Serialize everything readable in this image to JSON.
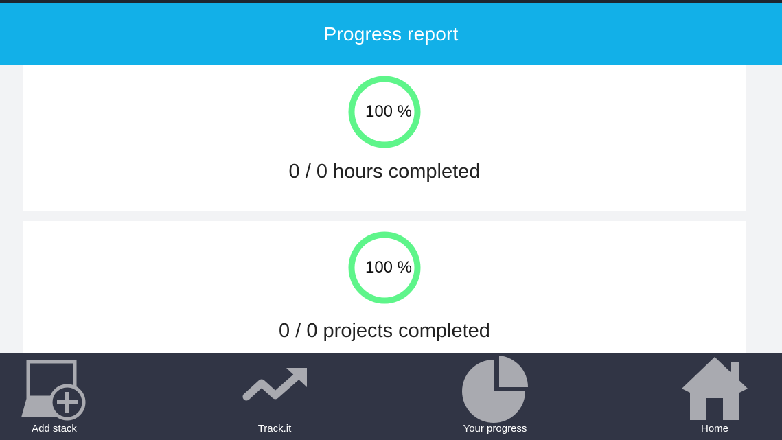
{
  "header": {
    "title": "Progress report",
    "background_color": "#12b0e8"
  },
  "cards": {
    "hours": {
      "percent_label": "100 %",
      "percent_value": 100,
      "caption": "0 / 0 hours completed"
    },
    "projects": {
      "percent_label": "100 %",
      "percent_value": 100,
      "caption": "0 / 0 projects completed"
    },
    "ring_color": "#5ef58a"
  },
  "bottom_nav": {
    "background_color": "#313545",
    "icon_color": "#a9aab0",
    "items": [
      {
        "label": "Add stack",
        "icon": "add-stack-icon"
      },
      {
        "label": "Track.it",
        "icon": "trend-arrow-icon"
      },
      {
        "label": "Your progress",
        "icon": "pie-chart-icon"
      },
      {
        "label": "Home",
        "icon": "home-icon"
      }
    ]
  }
}
